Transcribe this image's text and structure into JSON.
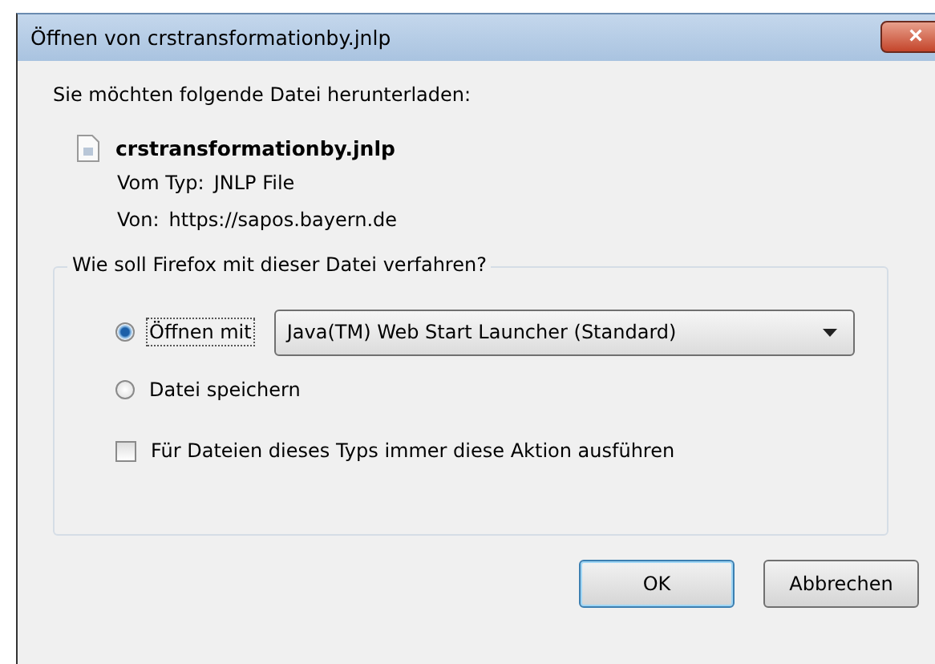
{
  "window": {
    "title": "Öffnen von crstransformationby.jnlp",
    "close": "×"
  },
  "intro": "Sie möchten folgende Datei herunterladen:",
  "file": {
    "name": "crstransformationby.jnlp",
    "type_label": "Vom Typ:",
    "type": "JNLP File",
    "from_label": "Von:",
    "from": "https://sapos.bayern.de"
  },
  "group": {
    "legend": "Wie soll Firefox mit dieser Datei verfahren?",
    "options": [
      {
        "label": "Öffnen mit",
        "selected": true
      },
      {
        "label": "Datei speichern",
        "selected": false
      }
    ],
    "app_select": {
      "value": "Java(TM) Web Start Launcher (Standard)"
    },
    "remember": {
      "label": "Für Dateien dieses Typs immer diese Aktion ausführen",
      "checked": false
    }
  },
  "buttons": [
    {
      "label": "OK",
      "default": true
    },
    {
      "label": "Abbrechen",
      "default": false
    }
  ]
}
